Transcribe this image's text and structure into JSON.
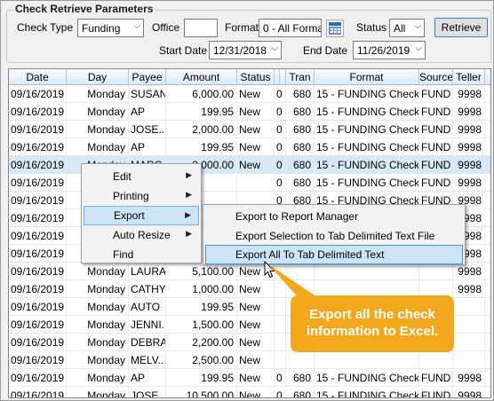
{
  "params": {
    "title": "Check Retrieve Parameters",
    "check_type_label": "Check Type",
    "check_type_value": "Funding",
    "office_label": "Office",
    "office_value": "",
    "format_label": "Format",
    "format_value": "0 - All Formats",
    "status_label": "Status",
    "status_value": "All",
    "retrieve_label": "Retrieve",
    "start_date_label": "Start Date",
    "start_date_value": "12/31/2018",
    "end_date_label": "End Date",
    "end_date_value": "11/26/2019"
  },
  "grid": {
    "columns": [
      "Date",
      "Day",
      "Payee",
      "Amount",
      "Status",
      "",
      "",
      "Tran",
      "Format",
      "Source",
      "Teller",
      "#"
    ],
    "rows": [
      {
        "date": "09/16/2019",
        "day": "Monday",
        "payee": "SUSAN",
        "amount": "6,000.00",
        "status": "New",
        "c": "0",
        "tran": "680",
        "format": "15 - FUNDING Check",
        "source": "FUND",
        "teller": "9998"
      },
      {
        "date": "09/16/2019",
        "day": "Monday",
        "payee": "AP",
        "amount": "199.95",
        "status": "New",
        "c": "0",
        "tran": "680",
        "format": "15 - FUNDING Check",
        "source": "FUND",
        "teller": "9998"
      },
      {
        "date": "09/16/2019",
        "day": "Monday",
        "payee": "JOSE...",
        "amount": "2,000.00",
        "status": "New",
        "c": "0",
        "tran": "680",
        "format": "15 - FUNDING Check",
        "source": "FUND",
        "teller": "9998"
      },
      {
        "date": "09/16/2019",
        "day": "Monday",
        "payee": "AP",
        "amount": "199.95",
        "status": "New",
        "c": "0",
        "tran": "680",
        "format": "15 - FUNDING Check",
        "source": "FUND",
        "teller": "9998"
      },
      {
        "date": "09/16/2019",
        "day": "Monday",
        "payee": "MARG...",
        "amount": "3,000.00",
        "status": "New",
        "c": "0",
        "tran": "680",
        "format": "15 - FUNDING Check",
        "source": "FUND",
        "teller": "9998"
      },
      {
        "date": "09/16/2019",
        "day": "",
        "payee": "",
        "amount": "",
        "status": "",
        "c": "0",
        "tran": "680",
        "format": "15 - FUNDING Check",
        "source": "FUND",
        "teller": "9998"
      },
      {
        "date": "09/16/2019",
        "day": "",
        "payee": "",
        "amount": "",
        "status": "",
        "c": "0",
        "tran": "680",
        "format": "15 - FUNDING Check",
        "source": "FUND",
        "teller": "9998"
      },
      {
        "date": "09/16/2019",
        "day": "",
        "payee": "",
        "amount": "",
        "status": "",
        "c": "",
        "tran": "",
        "format": "",
        "source": "",
        "teller": "9998"
      },
      {
        "date": "09/16/2019",
        "day": "",
        "payee": "",
        "amount": "",
        "status": "",
        "c": "",
        "tran": "",
        "format": "",
        "source": "",
        "teller": "9998"
      },
      {
        "date": "09/16/2019",
        "day": "",
        "payee": "",
        "amount": "",
        "status": "",
        "c": "",
        "tran": "",
        "format": "",
        "source": "",
        "teller": "9998"
      },
      {
        "date": "09/16/2019",
        "day": "Monday",
        "payee": "LAURA",
        "amount": "5,100.00",
        "status": "New",
        "c": "",
        "tran": "",
        "format": "",
        "source": "",
        "teller": "9998"
      },
      {
        "date": "09/16/2019",
        "day": "Monday",
        "payee": "CATHY",
        "amount": "1,000.00",
        "status": "New",
        "c": "",
        "tran": "",
        "format": "",
        "source": "",
        "teller": "9998"
      },
      {
        "date": "09/16/2019",
        "day": "Monday",
        "payee": "AUTO",
        "amount": "199.95",
        "status": "New",
        "c": "",
        "tran": "",
        "format": "",
        "source": "",
        "teller": ""
      },
      {
        "date": "09/16/2019",
        "day": "Monday",
        "payee": "JENNI...",
        "amount": "1,500.00",
        "status": "New",
        "c": "",
        "tran": "",
        "format": "",
        "source": "",
        "teller": ""
      },
      {
        "date": "09/16/2019",
        "day": "Monday",
        "payee": "DEBRA",
        "amount": "2,200.00",
        "status": "New",
        "c": "",
        "tran": "",
        "format": "",
        "source": "",
        "teller": ""
      },
      {
        "date": "09/16/2019",
        "day": "Monday",
        "payee": "MELV...",
        "amount": "2,500.00",
        "status": "New",
        "c": "",
        "tran": "",
        "format": "",
        "source": "",
        "teller": ""
      },
      {
        "date": "09/16/2019",
        "day": "Monday",
        "payee": "AP",
        "amount": "199.95",
        "status": "New",
        "c": "0",
        "tran": "680",
        "format": "15 - FUNDING Check",
        "source": "FUND",
        "teller": "9998"
      },
      {
        "date": "09/16/2019",
        "day": "Monday",
        "payee": "JOSE",
        "amount": "10,500.00",
        "status": "New",
        "c": "0",
        "tran": "680",
        "format": "15 - FUNDING Check",
        "source": "FUND",
        "teller": "9998"
      }
    ]
  },
  "context_menu": {
    "items": [
      "Edit",
      "Printing",
      "Export",
      "Auto Resize",
      "Find"
    ]
  },
  "export_submenu": {
    "items": [
      "Export to Report Manager",
      "Export Selection to Tab Delimited Text File",
      "Export All To Tab Delimited Text"
    ]
  },
  "callout": {
    "line1": "Export all the check",
    "line2": "information to Excel."
  },
  "colors": {
    "callout": "#f2a81d",
    "selection": "#d9e8f7",
    "menu_highlight": "#cde4f7"
  }
}
